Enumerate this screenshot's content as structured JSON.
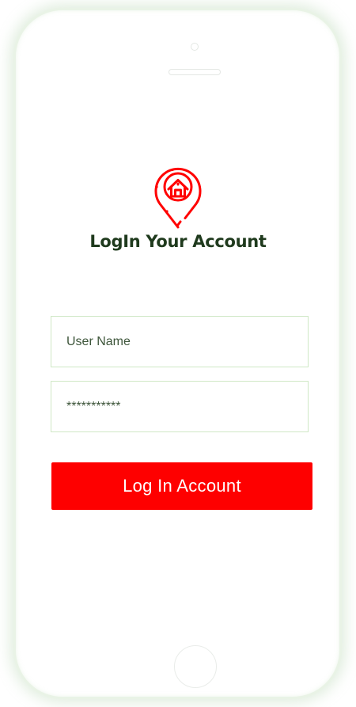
{
  "logo": {
    "icon": "home-location-pin-icon",
    "color": "#ff0000"
  },
  "title": "LogIn Your Account",
  "form": {
    "username": {
      "placeholder": "User Name",
      "value": ""
    },
    "password": {
      "value": "***********"
    },
    "submit_label": "Log In Account"
  },
  "colors": {
    "accent": "#fe0000",
    "title": "#1f3a1d",
    "field_border": "#cfe8c5",
    "field_text": "#3d553a"
  }
}
